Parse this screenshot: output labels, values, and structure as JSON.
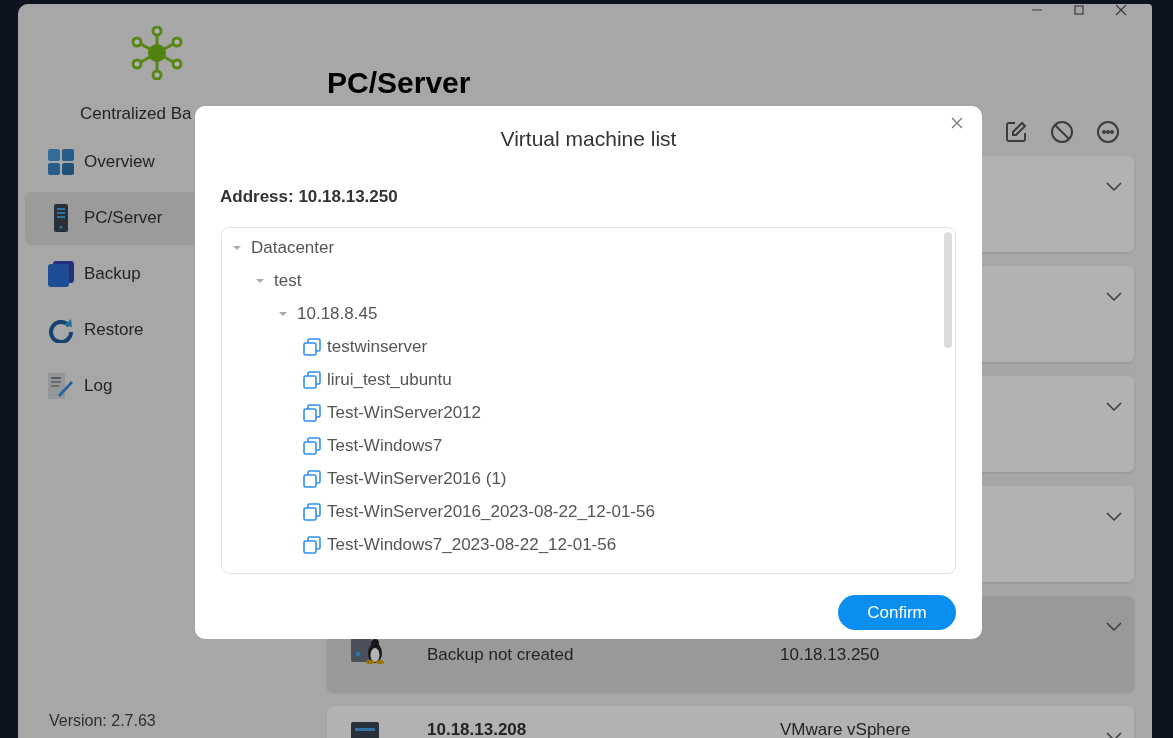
{
  "sidebar": {
    "app_name": "Centralized Ba",
    "items": [
      {
        "label": "Overview",
        "kind": "overview",
        "selected": false
      },
      {
        "label": "PC/Server",
        "kind": "server",
        "selected": true
      },
      {
        "label": "Backup",
        "kind": "backup",
        "selected": false
      },
      {
        "label": "Restore",
        "kind": "restore",
        "selected": false
      },
      {
        "label": "Log",
        "kind": "log",
        "selected": false
      }
    ],
    "version": "Version: 2.7.63"
  },
  "main": {
    "title": "PC/Server",
    "cards": [
      {
        "selected": false
      },
      {
        "selected": false
      },
      {
        "selected": false
      },
      {
        "selected": false
      },
      {
        "selected": true,
        "kind": "linux",
        "status": "Backup not created",
        "address": "10.18.13.250"
      },
      {
        "selected": false,
        "kind": "server",
        "name": "10.18.13.208",
        "platform": "VMware vSphere"
      }
    ]
  },
  "dialog": {
    "title": "Virtual machine list",
    "address": "Address: 10.18.13.250",
    "tree": [
      {
        "label": "Datacenter",
        "expanded": true,
        "children": [
          {
            "label": "test",
            "expanded": true,
            "children": [
              {
                "label": "10.18.8.45",
                "expanded": true,
                "children": [
                  {
                    "label": "testwinserver"
                  },
                  {
                    "label": "lirui_test_ubuntu"
                  },
                  {
                    "label": "Test-WinServer2012"
                  },
                  {
                    "label": "Test-Windows7"
                  },
                  {
                    "label": "Test-WinServer2016 (1)"
                  },
                  {
                    "label": "Test-WinServer2016_2023-08-22_12-01-56"
                  },
                  {
                    "label": "Test-Windows7_2023-08-22_12-01-56"
                  }
                ]
              }
            ]
          }
        ]
      }
    ],
    "confirm": "Confirm"
  }
}
